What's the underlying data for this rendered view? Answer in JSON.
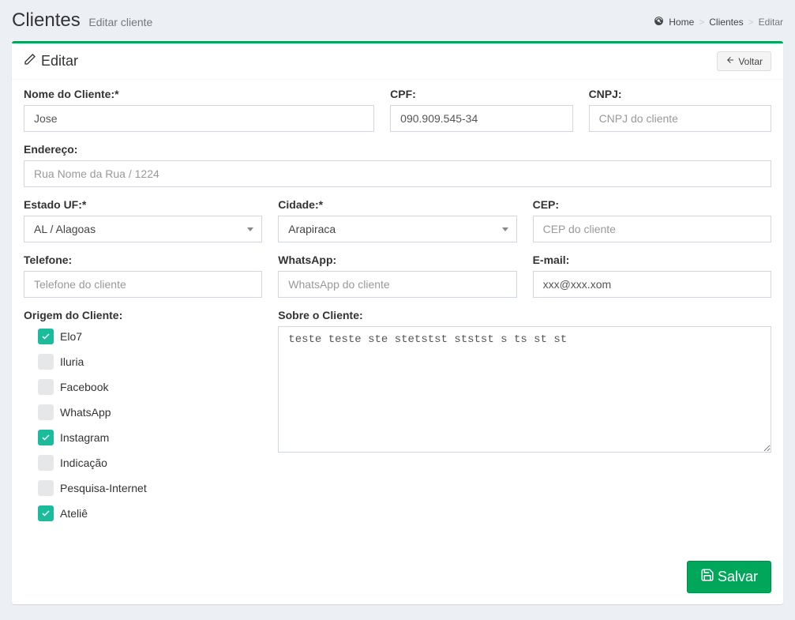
{
  "header": {
    "title": "Clientes",
    "subtitle": "Editar cliente"
  },
  "breadcrumb": {
    "home": "Home",
    "clientes": "Clientes",
    "editar": "Editar"
  },
  "box": {
    "title": "Editar",
    "voltar": "Voltar",
    "salvar": "Salvar"
  },
  "labels": {
    "nome": "Nome do Cliente:*",
    "cpf": "CPF:",
    "cnpj": "CNPJ:",
    "endereco": "Endereço:",
    "uf": "Estado UF:*",
    "cidade": "Cidade:*",
    "cep": "CEP:",
    "telefone": "Telefone:",
    "whatsapp": "WhatsApp:",
    "email": "E-mail:",
    "origem": "Origem do Cliente:",
    "sobre": "Sobre o Cliente:"
  },
  "values": {
    "nome": "Jose",
    "cpf": "090.909.545-34",
    "cnpj": "",
    "endereco": "",
    "uf": "AL / Alagoas",
    "cidade": "Arapiraca",
    "cep": "",
    "telefone": "",
    "whatsapp": "",
    "email": "xxx@xxx.xom",
    "sobre": "teste teste ste stetstst ststst s ts st st"
  },
  "placeholders": {
    "cnpj": "CNPJ do cliente",
    "endereco": "Rua Nome da Rua / 1224",
    "cep": "CEP do cliente",
    "telefone": "Telefone do cliente",
    "whatsapp": "WhatsApp do cliente"
  },
  "origins": [
    {
      "label": "Elo7",
      "checked": true
    },
    {
      "label": "Iluria",
      "checked": false
    },
    {
      "label": "Facebook",
      "checked": false
    },
    {
      "label": "WhatsApp",
      "checked": false
    },
    {
      "label": "Instagram",
      "checked": true
    },
    {
      "label": "Indicação",
      "checked": false
    },
    {
      "label": "Pesquisa-Internet",
      "checked": false
    },
    {
      "label": "Ateliê",
      "checked": true
    }
  ]
}
